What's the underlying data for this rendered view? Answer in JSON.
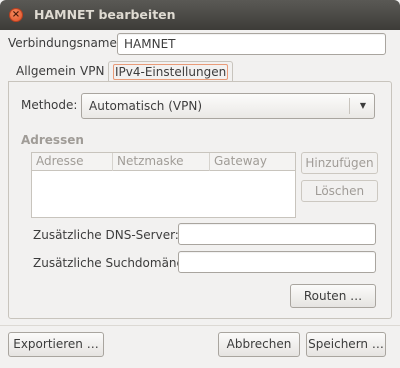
{
  "window": {
    "title": "HAMNET bearbeiten",
    "close_symbol": "×"
  },
  "connection": {
    "name_label": "Verbindungsname:",
    "name_value": "HAMNET"
  },
  "tabs": [
    {
      "label": "Allgemein",
      "active": false
    },
    {
      "label": "VPN",
      "active": false
    },
    {
      "label": "IPv4-Einstellungen",
      "active": true
    }
  ],
  "ipv4": {
    "method_label": "Methode:",
    "method_value": "Automatisch (VPN)",
    "addresses": {
      "title": "Adressen",
      "columns": [
        "Adresse",
        "Netzmaske",
        "Gateway"
      ],
      "rows": [],
      "add_label": "Hinzufügen",
      "delete_label": "Löschen"
    },
    "dns_label": "Zusätzliche DNS-Server:",
    "dns_value": "",
    "search_domains_label": "Zusätzliche Suchdomänen:",
    "search_domains_value": "",
    "routes_label": "Routen …"
  },
  "footer": {
    "export_label": "Exportieren …",
    "cancel_label": "Abbrechen",
    "save_label": "Speichern …"
  },
  "colors": {
    "titlebar": "#3d3c38",
    "close_button": "#e0532a",
    "active_tab_outline": "#e99b78",
    "window_bg": "#f2f1f0"
  }
}
